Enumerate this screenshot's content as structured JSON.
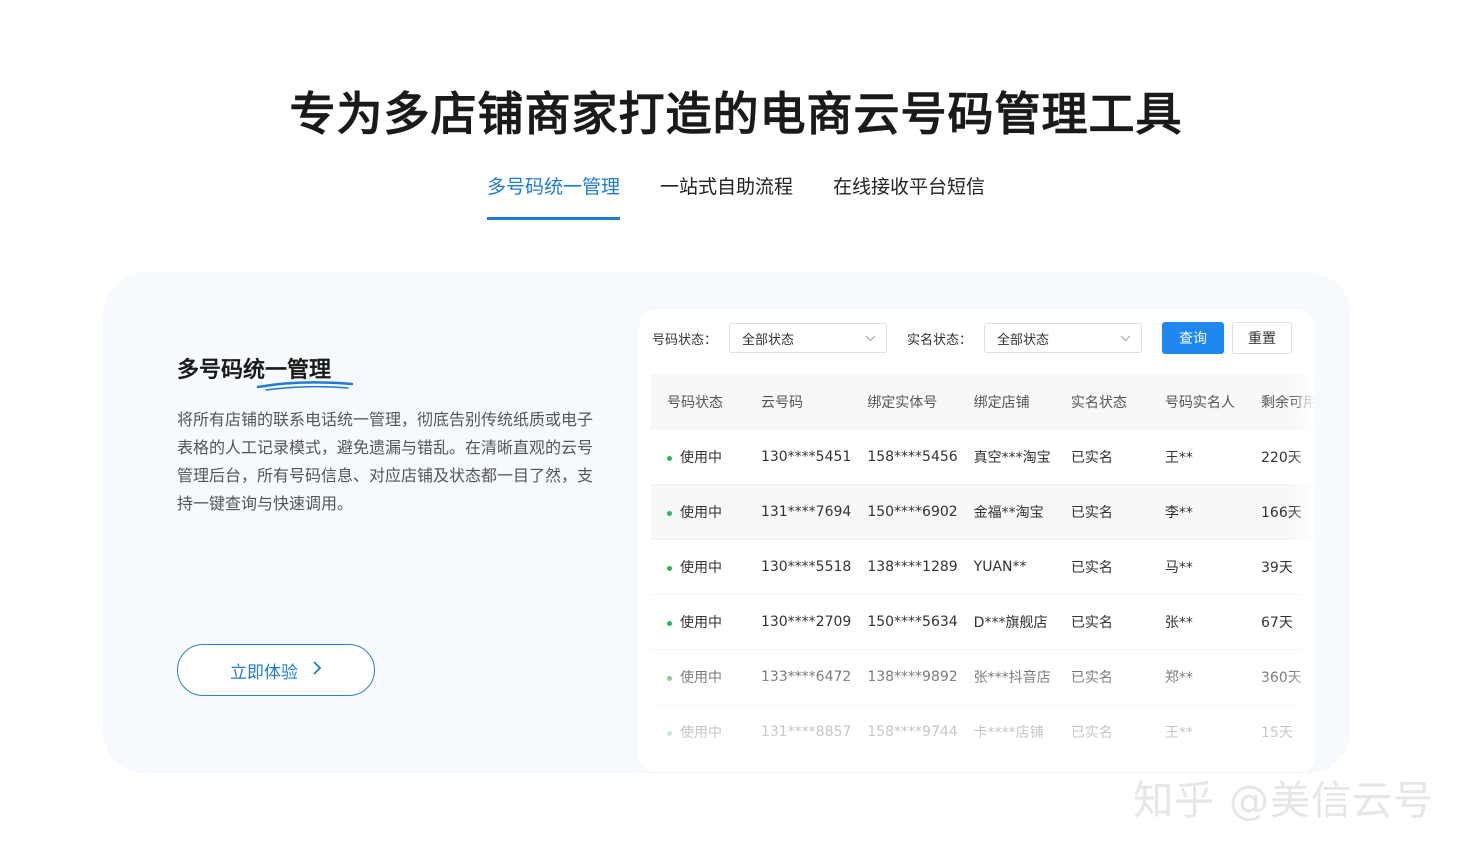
{
  "hero": {
    "title": "专为多店铺商家打造的电商云号码管理工具"
  },
  "tabs": [
    {
      "label": "多号码统一管理"
    },
    {
      "label": "一站式自助流程"
    },
    {
      "label": "在线接收平台短信"
    }
  ],
  "feature": {
    "title": "多号码统一管理",
    "description": "将所有店铺的联系电话统一管理，彻底告别传统纸质或电子表格的人工记录模式，避免遗漏与错乱。在清晰直观的云号管理后台，所有号码信息、对应店铺及状态都一目了然，支持一键查询与快速调用。",
    "cta_label": "立即体验",
    "cta_icon": "chevron-right-icon",
    "accent_color": "#1e7bd8"
  },
  "filters": {
    "number_status_label": "号码状态：",
    "number_status_value": "全部状态",
    "realname_status_label": "实名状态：",
    "realname_status_value": "全部状态",
    "query_label": "查询",
    "reset_label": "重置"
  },
  "table": {
    "headers": [
      "号码状态",
      "云号码",
      "绑定实体号",
      "绑定店铺",
      "实名状态",
      "号码实名人",
      "剩余可用时"
    ],
    "rows": [
      [
        "使用中",
        "130****5451",
        "158****5456",
        "真空***淘宝",
        "已实名",
        "王**",
        "220天"
      ],
      [
        "使用中",
        "131****7694",
        "150****6902",
        "金福**淘宝",
        "已实名",
        "李**",
        "166天"
      ],
      [
        "使用中",
        "130****5518",
        "138****1289",
        "YUAN**",
        "已实名",
        "马**",
        "39天"
      ],
      [
        "使用中",
        "130****2709",
        "150****5634",
        "D***旗舰店",
        "已实名",
        "张**",
        "67天"
      ],
      [
        "使用中",
        "133****6472",
        "138****9892",
        "张***抖音店",
        "已实名",
        "郑**",
        "360天"
      ],
      [
        "使用中",
        "131****8857",
        "158****9744",
        "卡****店铺",
        "已实名",
        "王**",
        "15天"
      ]
    ],
    "status_color": "#2fb55b"
  },
  "watermark": {
    "text": "知乎 @美信云号"
  }
}
